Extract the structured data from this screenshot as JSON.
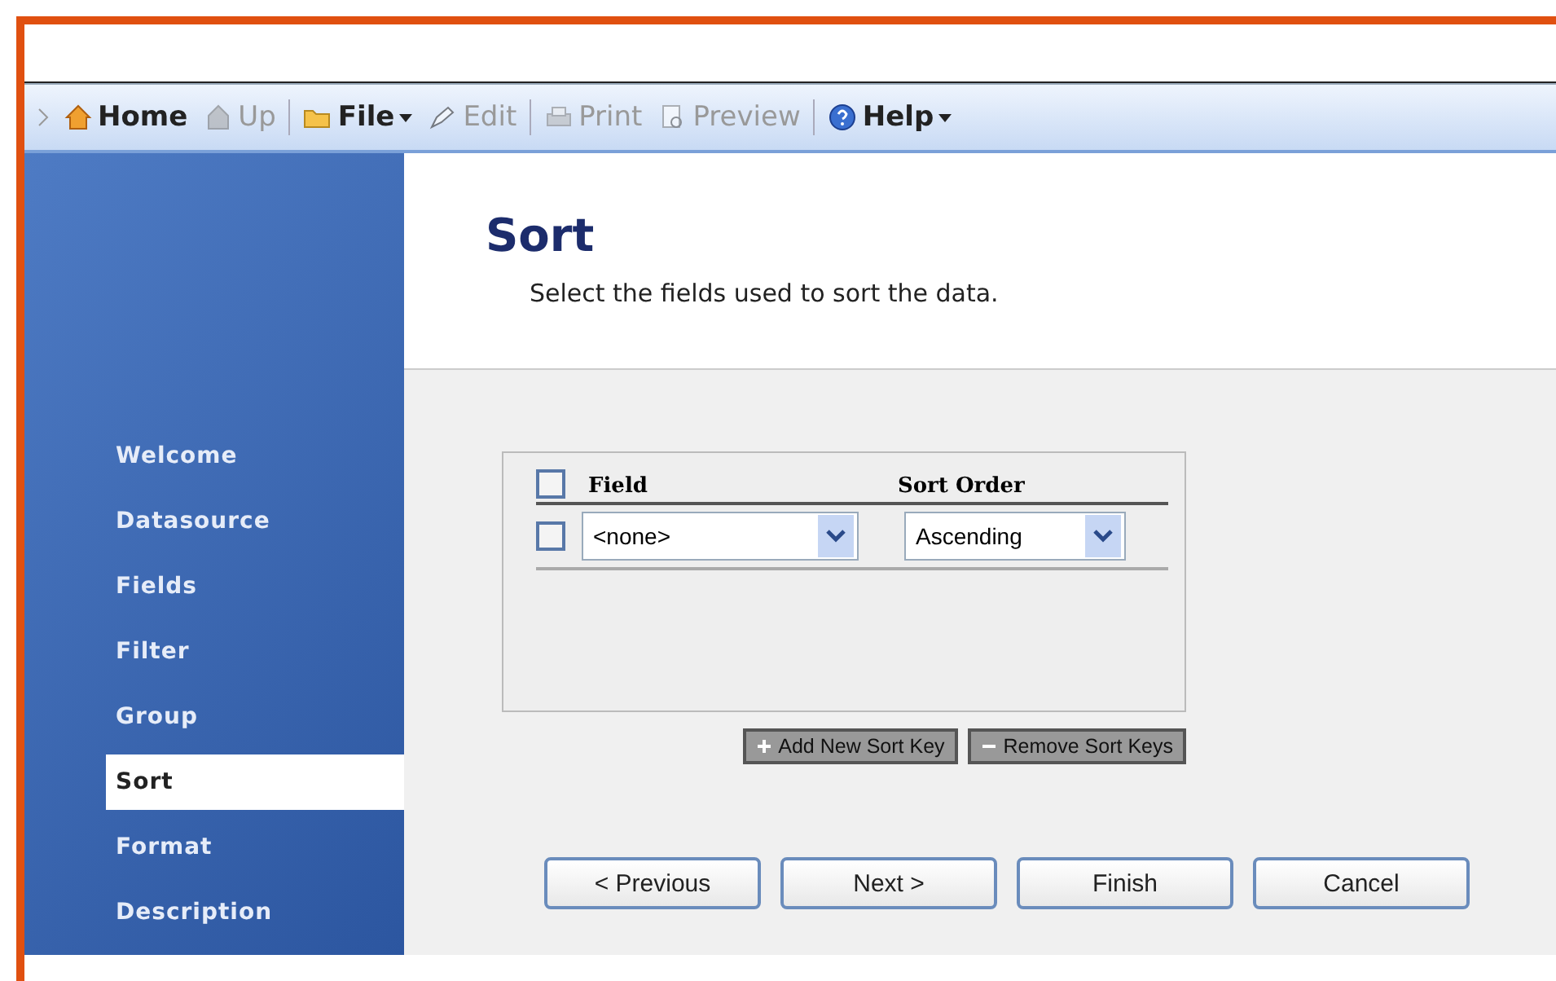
{
  "toolbar": [
    {
      "label": "Home",
      "kind": "home",
      "disabled": false,
      "dropdown": false
    },
    {
      "label": "Up",
      "kind": "up",
      "disabled": true,
      "dropdown": false
    },
    {
      "label": "File",
      "kind": "folder",
      "disabled": false,
      "dropdown": true
    },
    {
      "label": "Edit",
      "kind": "edit",
      "disabled": true,
      "dropdown": false
    },
    {
      "label": "Print",
      "kind": "print",
      "disabled": true,
      "dropdown": false
    },
    {
      "label": "Preview",
      "kind": "preview",
      "disabled": true,
      "dropdown": false
    },
    {
      "label": "Help",
      "kind": "help",
      "disabled": false,
      "dropdown": true
    }
  ],
  "sidebar": {
    "items": [
      {
        "label": "Welcome",
        "selected": false
      },
      {
        "label": "Datasource",
        "selected": false
      },
      {
        "label": "Fields",
        "selected": false
      },
      {
        "label": "Filter",
        "selected": false
      },
      {
        "label": "Group",
        "selected": false
      },
      {
        "label": "Sort",
        "selected": true
      },
      {
        "label": "Format",
        "selected": false
      },
      {
        "label": "Description",
        "selected": false
      }
    ]
  },
  "header": {
    "title": "Sort",
    "subtitle": "Select the fields used to sort the data."
  },
  "table": {
    "select_all_checked": false,
    "columns": [
      "Field",
      "Sort Order"
    ],
    "rows": [
      {
        "checked": false,
        "field": "<none>",
        "sort_order": "Ascending"
      }
    ]
  },
  "table_buttons": [
    {
      "label": "Add New Sort Key",
      "kind": "add"
    },
    {
      "label": "Remove Sort Keys",
      "kind": "remove"
    }
  ],
  "nav_buttons": [
    "< Previous",
    "Next >",
    "Finish",
    "Cancel"
  ]
}
